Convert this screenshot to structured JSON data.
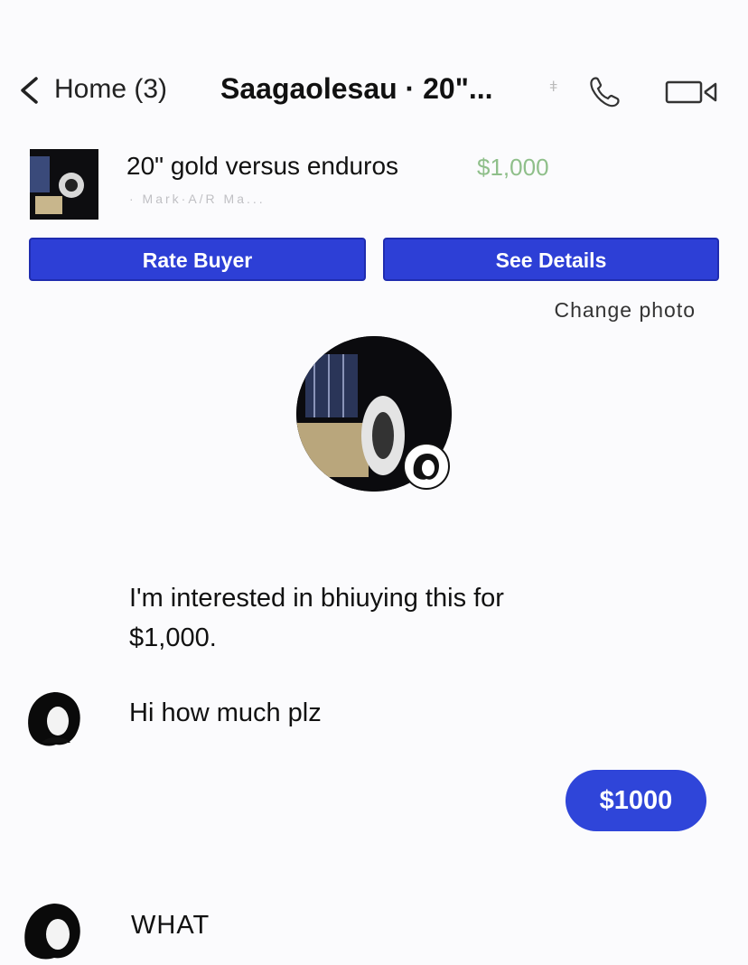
{
  "nav": {
    "back_label": "Home (3)",
    "title": "Saagaolesau · 20\"...",
    "icons": [
      "chevron-left-icon",
      "phone-icon",
      "video-camera-icon"
    ]
  },
  "listing": {
    "title": "20\" gold versus enduros",
    "price": "$1,000",
    "subtitle": "· Mark·A/R Ma..."
  },
  "actions": {
    "rate_buyer": "Rate Buyer",
    "see_details": "See Details"
  },
  "change_photo": "Change photo",
  "messages": [
    {
      "lines": [
        "I'm interested in bhiuying this for",
        "$1,000."
      ]
    },
    {
      "text": "Hi how much plz"
    },
    {
      "text": "$1000"
    },
    {
      "text": "WHAT"
    }
  ],
  "colors": {
    "accent_blue": "#2d3fd6",
    "price_green": "#8fbf8a",
    "background": "#fbfbfd"
  }
}
